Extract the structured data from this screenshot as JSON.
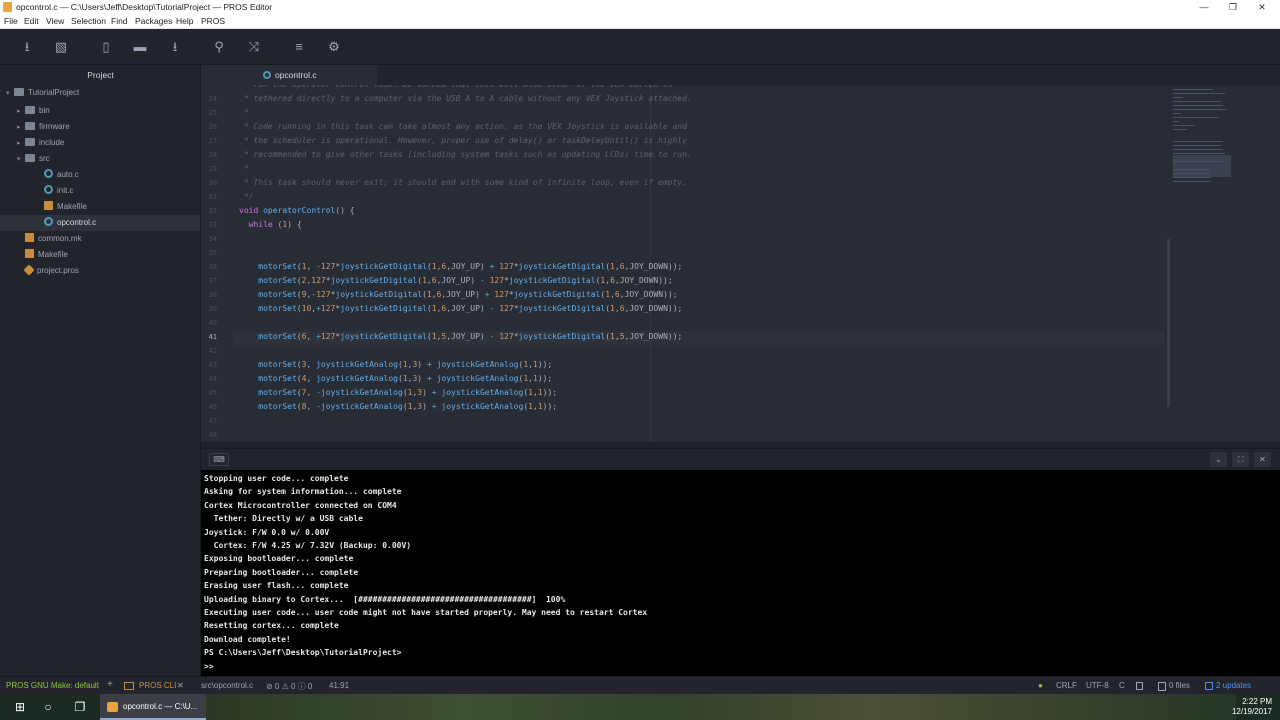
{
  "window": {
    "title": "opcontrol.c — C:\\Users\\Jeff\\Desktop\\TutorialProject — PROS Editor",
    "minimize": "—",
    "maximize": "❐",
    "close": "✕"
  },
  "menu": [
    "File",
    "Edit",
    "View",
    "Selection",
    "Find",
    "Packages",
    "Help",
    "PROS"
  ],
  "toolbar": {
    "icons": [
      "upload-icon",
      "image-icon",
      "new-file-icon",
      "folder-icon",
      "download-icon",
      "search-icon",
      "shuffle-icon",
      "list-icon",
      "gear-icon"
    ],
    "glyphs": [
      "⭳",
      "▧",
      "▯",
      "▬",
      "⭳",
      "⚲",
      "⤨",
      "≡",
      "⚙"
    ]
  },
  "sidebar": {
    "header": "Project",
    "items": [
      {
        "label": "TutorialProject",
        "kind": "repo",
        "chev": "▾"
      },
      {
        "label": "bin",
        "kind": "folder",
        "chev": "▸"
      },
      {
        "label": "firmware",
        "kind": "folder",
        "chev": "▸"
      },
      {
        "label": "include",
        "kind": "folder",
        "chev": "▸"
      },
      {
        "label": "src",
        "kind": "folder",
        "chev": "▾"
      },
      {
        "label": "auto.c",
        "kind": "cfile",
        "chev": ""
      },
      {
        "label": "init.c",
        "kind": "cfile",
        "chev": ""
      },
      {
        "label": "Makefile",
        "kind": "make",
        "chev": ""
      },
      {
        "label": "opcontrol.c",
        "kind": "cfile",
        "chev": ""
      },
      {
        "label": "common.mk",
        "kind": "make",
        "chev": ""
      },
      {
        "label": "Makefile",
        "kind": "make",
        "chev": ""
      },
      {
        "label": "project.pros",
        "kind": "pros",
        "chev": ""
      }
    ]
  },
  "editor": {
    "tab": "opcontrol.c",
    "lines": [
      {
        "n": "",
        "t": " * run the operator control task. Be warned that this will also occur if the VEX Cortex is",
        "c": "cm"
      },
      {
        "n": "24",
        "t": " * tethered directly to a computer via the USB A to A cable without any VEX Joystick attached.",
        "c": "cm"
      },
      {
        "n": "25",
        "t": " *",
        "c": "cm"
      },
      {
        "n": "26",
        "t": " * Code running in this task can take almost any action, as the VEX Joystick is available and",
        "c": "cm"
      },
      {
        "n": "27",
        "t": " * the scheduler is operational. However, proper use of delay() or taskDelayUntil() is highly",
        "c": "cm"
      },
      {
        "n": "28",
        "t": " * recommended to give other tasks (including system tasks such as updating LCDs) time to run.",
        "c": "cm"
      },
      {
        "n": "29",
        "t": " *",
        "c": "cm"
      },
      {
        "n": "30",
        "t": " * This task should never exit; it should end with some kind of infinite loop, even if empty.",
        "c": "cm"
      },
      {
        "n": "31",
        "t": " */",
        "c": "cm"
      },
      {
        "n": "32",
        "t": "void operatorControl() {",
        "c": "code"
      },
      {
        "n": "33",
        "t": "  while (1) {",
        "c": "code"
      },
      {
        "n": "34",
        "t": "",
        "c": "code"
      },
      {
        "n": "35",
        "t": "",
        "c": "code"
      },
      {
        "n": "36",
        "t": "    motorSet(1, -127*joystickGetDigital(1,6,JOY_UP) + 127*joystickGetDigital(1,6,JOY_DOWN));",
        "c": "code"
      },
      {
        "n": "37",
        "t": "    motorSet(2,127*joystickGetDigital(1,6,JOY_UP) - 127*joystickGetDigital(1,6,JOY_DOWN));",
        "c": "code"
      },
      {
        "n": "38",
        "t": "    motorSet(9,-127*joystickGetDigital(1,6,JOY_UP) + 127*joystickGetDigital(1,6,JOY_DOWN));",
        "c": "code"
      },
      {
        "n": "39",
        "t": "    motorSet(10,+127*joystickGetDigital(1,6,JOY_UP) - 127*joystickGetDigital(1,6,JOY_DOWN));",
        "c": "code"
      },
      {
        "n": "40",
        "t": "",
        "c": "code"
      },
      {
        "n": "41",
        "t": "    motorSet(6, +127*joystickGetDigital(1,5,JOY_UP) - 127*joystickGetDigital(1,5,JOY_DOWN));",
        "c": "code"
      },
      {
        "n": "42",
        "t": "",
        "c": "code"
      },
      {
        "n": "43",
        "t": "    motorSet(3, joystickGetAnalog(1,3) + joystickGetAnalog(1,1));",
        "c": "code"
      },
      {
        "n": "44",
        "t": "    motorSet(4, joystickGetAnalog(1,3) + joystickGetAnalog(1,1));",
        "c": "code"
      },
      {
        "n": "45",
        "t": "    motorSet(7, -joystickGetAnalog(1,3) + joystickGetAnalog(1,1));",
        "c": "code"
      },
      {
        "n": "46",
        "t": "    motorSet(8, -joystickGetAnalog(1,3) + joystickGetAnalog(1,1));",
        "c": "code"
      },
      {
        "n": "47",
        "t": "",
        "c": "code"
      },
      {
        "n": "48",
        "t": "",
        "c": "code"
      }
    ],
    "current_line": "41"
  },
  "panel": {
    "keyboard_icon": "⌨",
    "controls": [
      "⌄",
      "⛶",
      "✕"
    ]
  },
  "terminal": {
    "lines": [
      "Stopping user code... complete",
      "Asking for system information... complete",
      "Cortex Microcontroller connected on COM4",
      "  Tether: Directly w/ a USB cable",
      "Joystick: F/W 0.0 w/ 0.00V",
      "  Cortex: F/W 4.25 w/ 7.32V (Backup: 0.00V)",
      "Exposing bootloader... complete",
      "Preparing bootloader... complete",
      "Erasing user flash... complete",
      "Uploading binary to Cortex...  [####################################]  100%",
      "Executing user code... user code might not have started properly. May need to restart Cortex",
      "Resetting cortex... complete",
      "Download complete!",
      "PS C:\\Users\\Jeff\\Desktop\\TutorialProject>",
      ">>"
    ]
  },
  "statusbar": {
    "make": "PROS GNU Make: default",
    "plus": "+",
    "cli": "PROS CLI",
    "cli_close": "✕",
    "path": "src\\opcontrol.c",
    "issues": "⊘ 0 ⚠ 0 ⓘ 0",
    "cursor": "41:91",
    "dot": "●",
    "eol": "CRLF",
    "encoding": "UTF-8",
    "grammar": "C",
    "files": "0 files",
    "updates": "2 updates"
  },
  "taskbar": {
    "app_label": "opcontrol.c — C:\\U...",
    "time": "2:22 PM",
    "date": "12/19/2017",
    "start": "⊞",
    "search": "○",
    "taskview": "❐"
  }
}
